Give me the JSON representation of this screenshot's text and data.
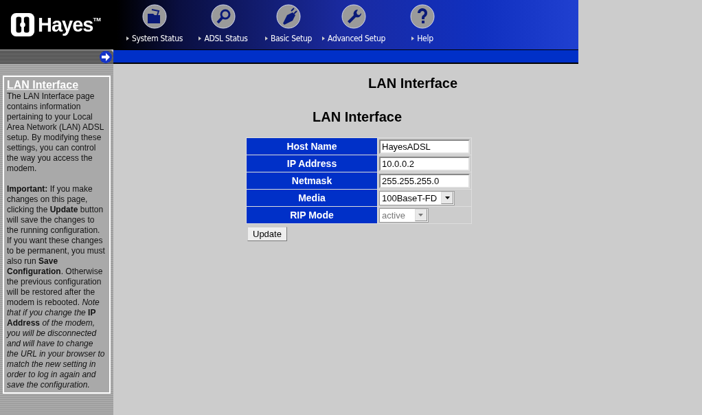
{
  "header": {
    "logo": "Hayes",
    "trademark": "TM",
    "nav": [
      {
        "label": "System Status"
      },
      {
        "label": "ADSL Status"
      },
      {
        "label": "Basic Setup"
      },
      {
        "label": "Advanced Setup"
      },
      {
        "label": "Help"
      }
    ]
  },
  "sidebar": {
    "title": "LAN Interface",
    "paragraphs": [
      "The LAN Interface page contains information pertaining to your Local Area Network (LAN) ADSL setup. By modifying these settings, you can control the way you access the modem.",
      "**Important:** If you make changes on this page, clicking the **Update** button will save the changes to the running configuration. If you want these changes to be permanent, you must also run **Save Configuration**. Otherwise the previous configuration will be restored after the modem is rebooted. *Note that if you change the* **IP Address** *of the modem, you will be disconnected and will have to change the URL in your browser to match the new setting in order to log in again and save the configuration.*"
    ]
  },
  "page_title": "LAN Interface",
  "form": {
    "title": "LAN Interface",
    "rows": [
      {
        "label": "Host Name",
        "kind": "text",
        "value": "HayesADSL",
        "disabled": false
      },
      {
        "label": "IP Address",
        "kind": "text",
        "value": "10.0.0.2",
        "disabled": false
      },
      {
        "label": "Netmask",
        "kind": "text",
        "value": "255.255.255.0",
        "disabled": false
      },
      {
        "label": "Media",
        "kind": "select",
        "value": "100BaseT-FD",
        "disabled": false
      },
      {
        "label": "RIP Mode",
        "kind": "select",
        "value": "active",
        "disabled": true
      }
    ],
    "button": "Update"
  }
}
